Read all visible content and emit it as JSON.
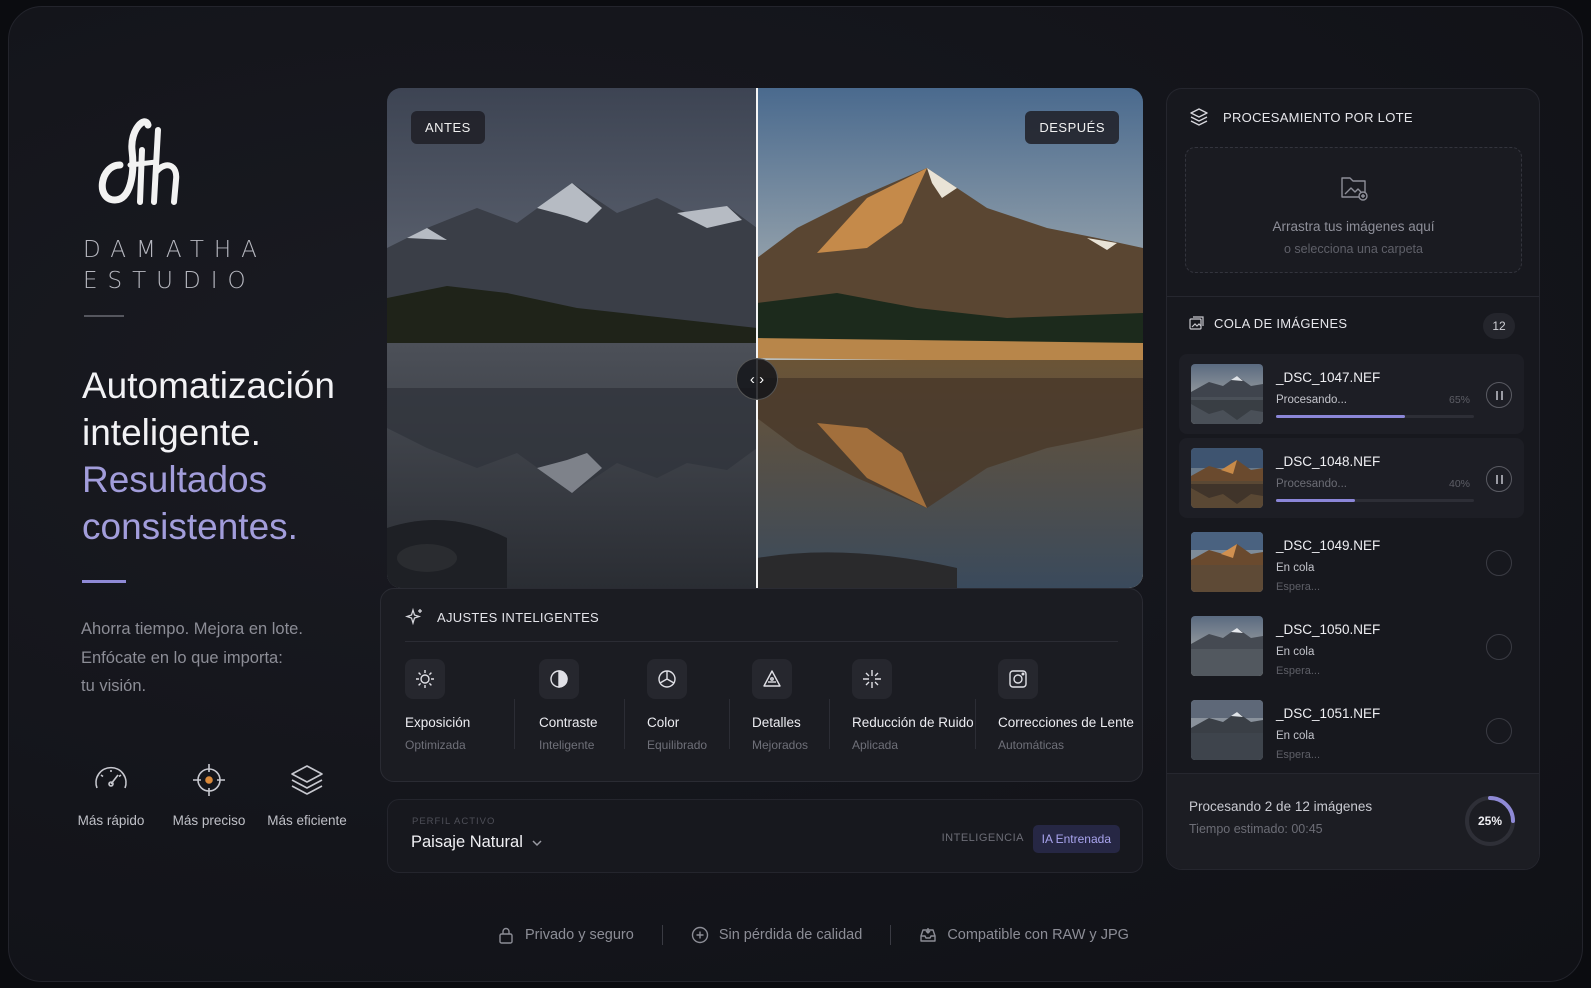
{
  "brand": {
    "logo_text": "dth",
    "name_line1": "DAMATHA",
    "name_line2": "ESTUDIO"
  },
  "hero": {
    "headline_line1": "Automatización",
    "headline_line2": "inteligente.",
    "accent_line1": "Resultados",
    "accent_line2": "consistentes.",
    "sub_line1": "Ahorra tiempo. Mejora en lote.",
    "sub_line2": "Enfócate en lo que importa:",
    "sub_line3": "tu visión."
  },
  "features": [
    {
      "icon": "speedometer-icon",
      "label": "Más rápido"
    },
    {
      "icon": "crosshair-icon",
      "label": "Más preciso"
    },
    {
      "icon": "layers-icon",
      "label": "Más eficiente"
    }
  ],
  "preview": {
    "before_label": "ANTES",
    "after_label": "DESPUÉS",
    "handle_glyph": "‹ ›"
  },
  "smart": {
    "title": "AJUSTES INTELIGENTES",
    "items": [
      {
        "icon": "sun-icon",
        "title": "Exposición",
        "subtitle": "Optimizada"
      },
      {
        "icon": "contrast-icon",
        "title": "Contraste",
        "subtitle": "Inteligente"
      },
      {
        "icon": "color-wheel-icon",
        "title": "Color",
        "subtitle": "Equilibrado"
      },
      {
        "icon": "triangle-detail-icon",
        "title": "Detalles",
        "subtitle": "Mejorados"
      },
      {
        "icon": "sparkle-icon",
        "title": "Reducción de Ruido",
        "subtitle": "Aplicada"
      },
      {
        "icon": "lens-icon",
        "title": "Correcciones de Lente",
        "subtitle": "Automáticas"
      }
    ]
  },
  "profile": {
    "label": "PERFIL ACTIVO",
    "value": "Paisaje Natural",
    "intel_label": "INTELIGENCIA",
    "intel_badge": "IA Entrenada"
  },
  "batch": {
    "title": "PROCESAMIENTO POR LOTE",
    "drop_line1": "Arrastra tus imágenes aquí",
    "drop_line2": "o selecciona una carpeta",
    "queue_title": "COLA DE IMÁGENES",
    "queue_count": "12",
    "queue": [
      {
        "name": "_DSC_1047.NEF",
        "status": "Procesando...",
        "percent": "65%",
        "progress": 0.65,
        "state": "processing"
      },
      {
        "name": "_DSC_1048.NEF",
        "status": "Procesando...",
        "percent": "40%",
        "progress": 0.4,
        "state": "processing"
      },
      {
        "name": "_DSC_1049.NEF",
        "status": "En cola",
        "sub": "Espera...",
        "state": "queued"
      },
      {
        "name": "_DSC_1050.NEF",
        "status": "En cola",
        "sub": "Espera...",
        "state": "queued"
      },
      {
        "name": "_DSC_1051.NEF",
        "status": "En cola",
        "sub": "Espera...",
        "state": "queued"
      }
    ],
    "footer_line1": "Procesando 2 de 12 imágenes",
    "footer_line2": "Tiempo estimado: 00:45",
    "overall_percent": "25%",
    "overall_progress": 0.25
  },
  "footer": [
    {
      "icon": "lock-icon",
      "label": "Privado y seguro"
    },
    {
      "icon": "plus-circle-icon",
      "label": "Sin pérdida de calidad"
    },
    {
      "icon": "tray-icon",
      "label": "Compatible con RAW y JPG"
    }
  ],
  "colors": {
    "accent": "#8f8ad6",
    "background": "#14151b"
  }
}
